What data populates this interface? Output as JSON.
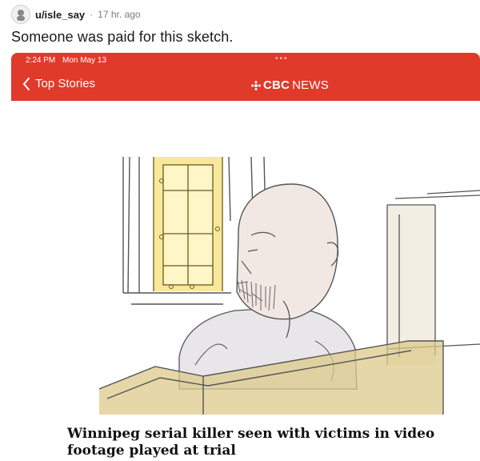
{
  "post": {
    "username": "u/isle_say",
    "separator": "·",
    "timestamp": "17 hr. ago",
    "title": "Someone was paid for this sketch.",
    "avatar_icon": "avatar-icon"
  },
  "screenshot": {
    "status": {
      "time": "2:24 PM",
      "date": "Mon May 13",
      "dots": "•••"
    },
    "nav": {
      "back_label": "Top Stories",
      "back_icon": "chevron-left-icon",
      "brand_logo": "cbc-gem-icon",
      "brand_cbc": "CBC",
      "brand_news": "NEWS",
      "bar_color": "#e03a2a"
    },
    "image": {
      "description_icon": "courtroom-sketch"
    },
    "headline": "Winnipeg serial killer seen with victims in video footage played at trial"
  }
}
